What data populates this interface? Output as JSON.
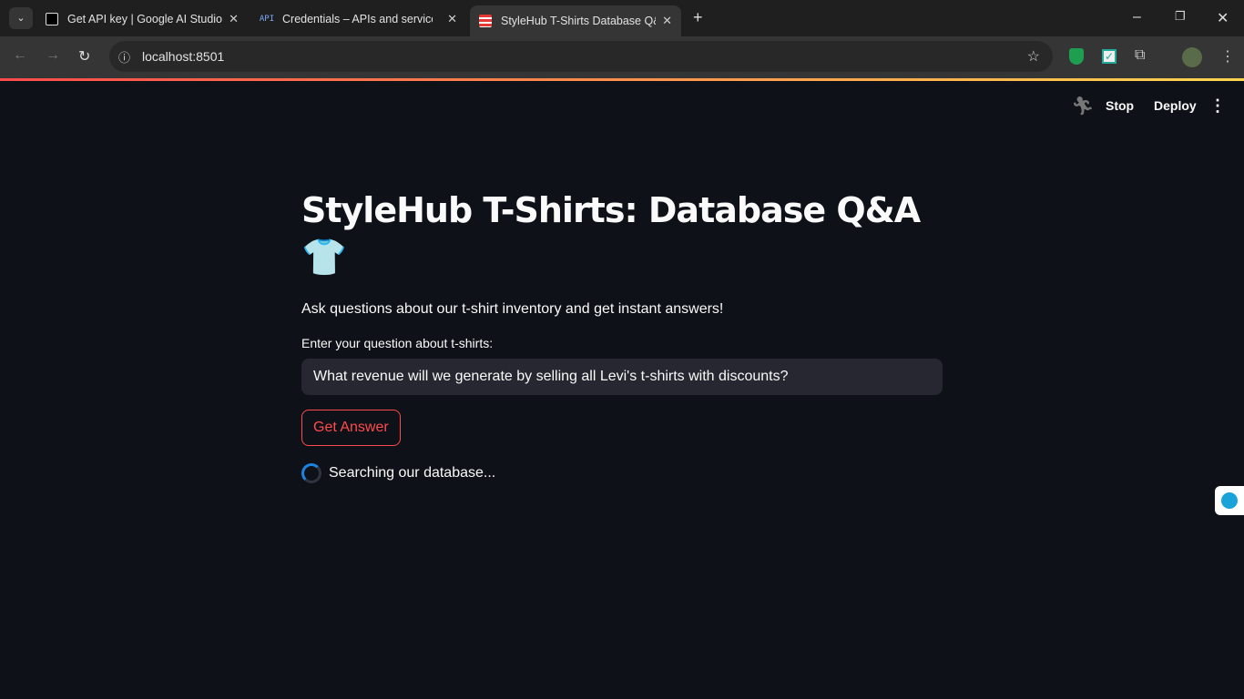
{
  "browser": {
    "tabs": [
      {
        "title": "Get API key | Google AI Studio",
        "icon": "ai-studio-icon"
      },
      {
        "title": "Credentials – APIs and services",
        "icon": "api-icon",
        "icon_text": "API"
      },
      {
        "title": "StyleHub T-Shirts Database Q&A",
        "icon": "tshirt-icon",
        "active": true
      }
    ],
    "url": "localhost:8501"
  },
  "app_header": {
    "stop": "Stop",
    "deploy": "Deploy"
  },
  "main": {
    "title": "StyleHub T-Shirts: Database Q&A",
    "emoji": "👕",
    "subtitle": "Ask questions about our t-shirt inventory and get instant answers!",
    "input_label": "Enter your question about t-shirts:",
    "input_value": "What revenue will we generate by selling all Levi's t-shirts with discounts?",
    "button": "Get Answer",
    "status": "Searching our database..."
  },
  "colors": {
    "accent": "#ff4b4b",
    "background": "#0e1117"
  }
}
